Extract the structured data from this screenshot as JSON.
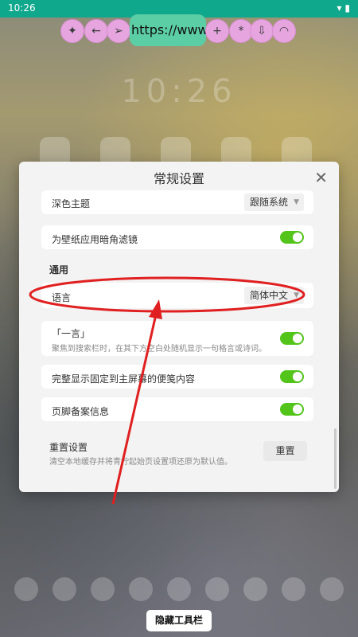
{
  "status_bar": {
    "time": "10:26",
    "icons": [
      "wifi-icon",
      "battery-icon"
    ]
  },
  "toolbar": {
    "url_text": "https://www.li",
    "icons": [
      "compass-icon",
      "arrow-left-icon",
      "send-arrow-icon",
      "plus-icon",
      "star-icon",
      "download-icon",
      "refresh-icon"
    ]
  },
  "panel": {
    "title": "常规设置",
    "dark_theme": {
      "label": "深色主题",
      "value": "跟随系统"
    },
    "wallpaper_filter": {
      "label": "为壁纸应用暗角滤镜",
      "enabled": true
    },
    "section_general": "通用",
    "language": {
      "label": "语言",
      "value": "简体中文"
    },
    "yiyan": {
      "label": "「一言」",
      "description": "聚焦到搜索栏时，在其下方空白处随机显示一句格言或诗词。",
      "enabled": true
    },
    "pinned_notes": {
      "label": "完整显示固定到主屏幕的便笺内容",
      "enabled": true
    },
    "footer_info": {
      "label": "页脚备案信息",
      "enabled": true
    },
    "reset": {
      "title": "重置设置",
      "description": "清空本地缓存并将青柠起始页设置项还原为默认值。",
      "button": "重置"
    }
  },
  "bottom_button": "隐藏工具栏",
  "colors": {
    "status_bar": "#0fa88c",
    "toolbar_button": "#e7a5e0",
    "url_bar": "#5ccea6",
    "toggle_on": "#52c41a",
    "annotation": "#e02020"
  }
}
